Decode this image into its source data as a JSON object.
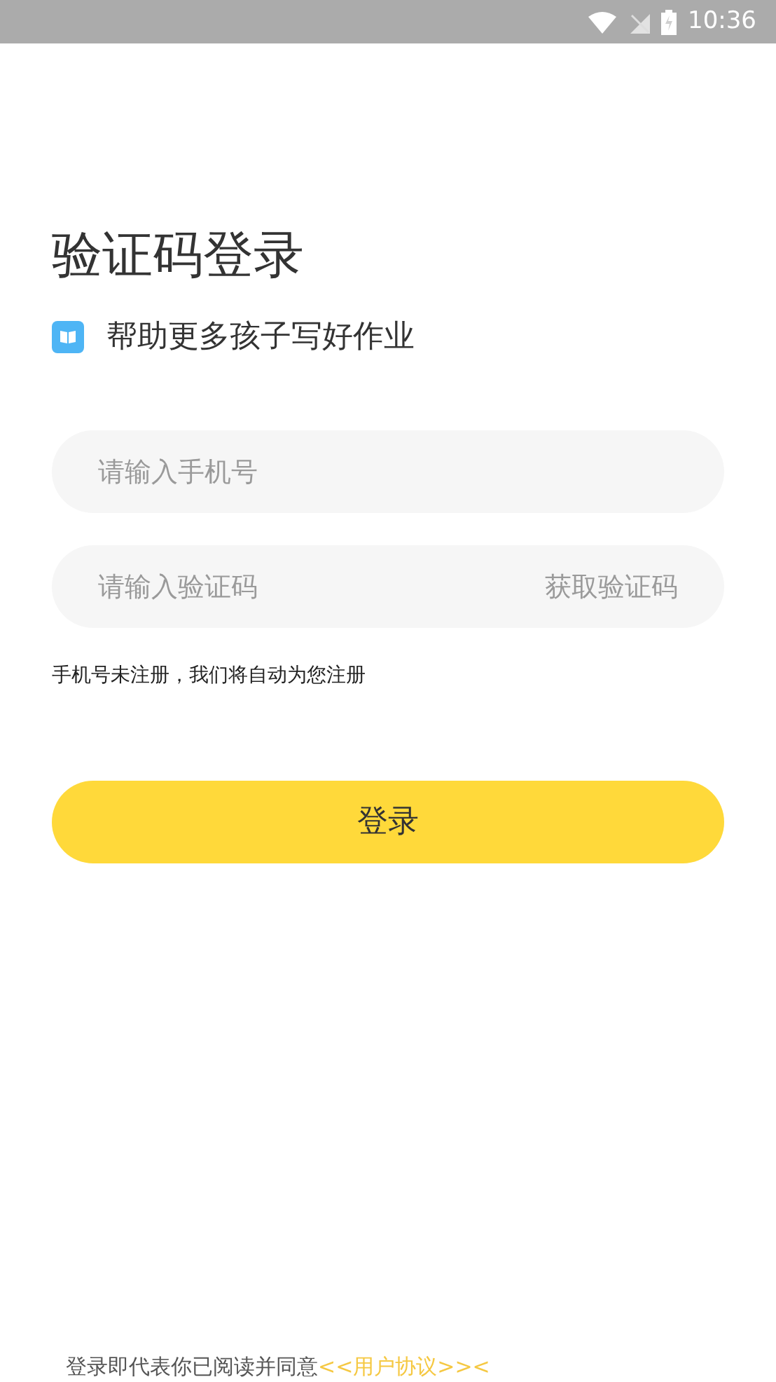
{
  "status_bar": {
    "time": "10:36"
  },
  "title": "验证码登录",
  "slogan": "帮助更多孩子写好作业",
  "phone_field": {
    "placeholder": "请输入手机号"
  },
  "code_field": {
    "placeholder": "请输入验证码",
    "action": "获取验证码"
  },
  "note": "手机号未注册，我们将自动为您注册",
  "login_button": "登录",
  "footer": {
    "text": "登录即代表你已阅读并同意",
    "link": "<<用户协议>><"
  }
}
